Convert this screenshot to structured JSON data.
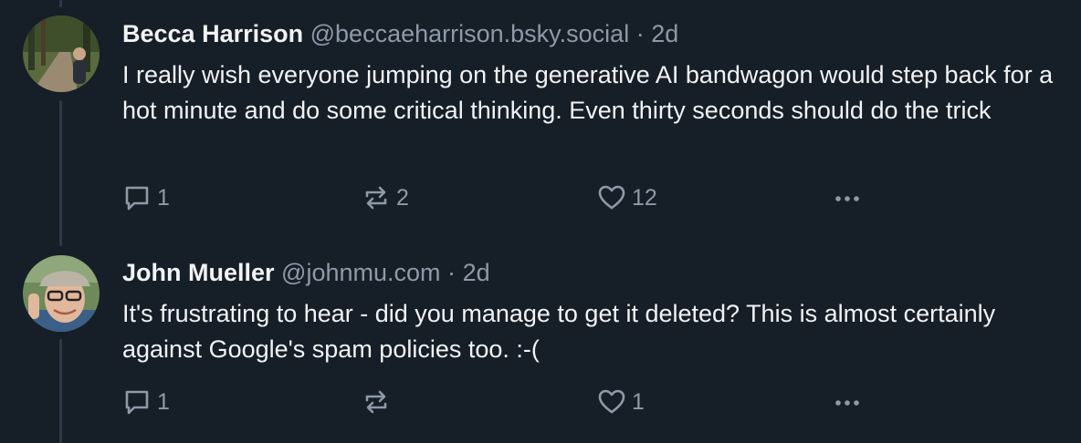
{
  "posts": [
    {
      "author": "Becca Harrison",
      "handle": "@beccaeharrison.bsky.social",
      "separator": "·",
      "time": "2d",
      "text": "I really wish everyone jumping on the generative AI bandwagon would step back for a hot minute and do some critical thinking. Even thirty seconds should do the trick",
      "replies": "1",
      "reposts": "2",
      "likes": "12"
    },
    {
      "author": "John Mueller",
      "handle": "@johnmu.com",
      "separator": "·",
      "time": "2d",
      "text": "It's frustrating to hear - did you manage to get it deleted? This is almost certainly against Google's spam policies too. :-(",
      "replies": "1",
      "reposts": "",
      "likes": "1"
    }
  ],
  "icons": {
    "reply": "reply-icon",
    "repost": "repost-icon",
    "like": "heart-icon",
    "more": "more-options-icon"
  },
  "colors": {
    "background": "#161e27",
    "text": "#f1f3f5",
    "muted": "#8d9aa8",
    "thread_line": "#2e3a47"
  }
}
